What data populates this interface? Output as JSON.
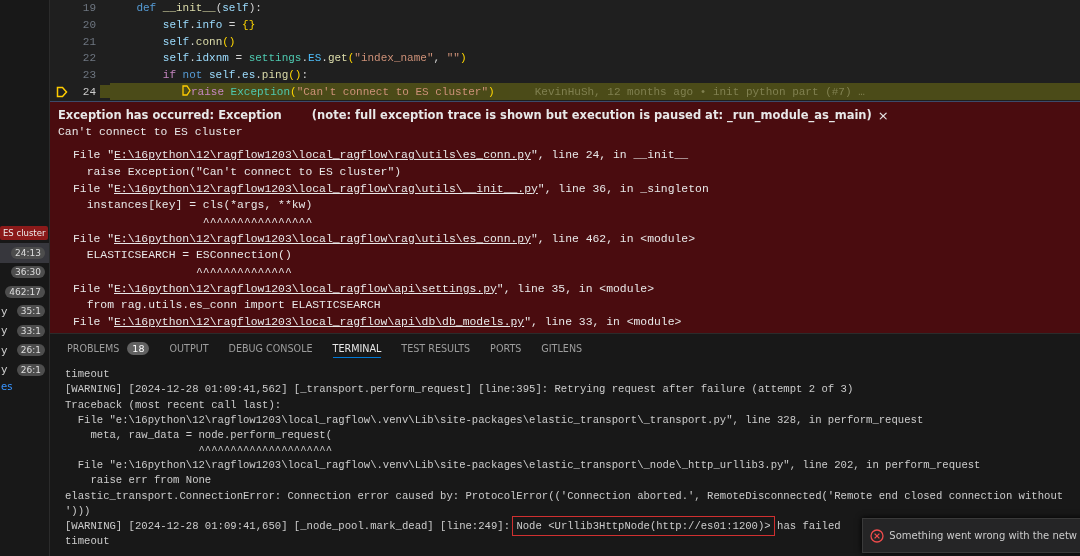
{
  "call_stack": {
    "exception_badge": "ES cluster",
    "frames": [
      {
        "position": "24:13",
        "selected": true
      },
      {
        "position": "36:30",
        "selected": false
      },
      {
        "position": "462:17",
        "selected": false
      },
      {
        "name": "y",
        "position": "35:1",
        "selected": false
      },
      {
        "name": "y",
        "position": "33:1",
        "selected": false
      },
      {
        "name": "y",
        "position": "26:1",
        "selected": false
      },
      {
        "name": "y",
        "position": "26:1",
        "selected": false
      }
    ],
    "more_link": "es"
  },
  "editor": {
    "lines": [
      {
        "number": "19",
        "current": false,
        "tokens": [
          {
            "kind": "keyword",
            "text": "    def"
          },
          {
            "kind": "function",
            "text": " __init__"
          },
          {
            "kind": "plain",
            "text": "("
          },
          {
            "kind": "variable",
            "text": "self"
          },
          {
            "kind": "plain",
            "text": "):"
          }
        ]
      },
      {
        "number": "20",
        "current": false,
        "tokens": [
          {
            "kind": "variable",
            "text": "        self"
          },
          {
            "kind": "plain",
            "text": "."
          },
          {
            "kind": "variable",
            "text": "info"
          },
          {
            "kind": "plain",
            "text": " = "
          },
          {
            "kind": "bracket",
            "text": "{}"
          }
        ]
      },
      {
        "number": "21",
        "current": false,
        "tokens": [
          {
            "kind": "variable",
            "text": "        self"
          },
          {
            "kind": "plain",
            "text": "."
          },
          {
            "kind": "function",
            "text": "conn"
          },
          {
            "kind": "bracket",
            "text": "()"
          }
        ]
      },
      {
        "number": "22",
        "current": false,
        "tokens": [
          {
            "kind": "variable",
            "text": "        self"
          },
          {
            "kind": "plain",
            "text": "."
          },
          {
            "kind": "variable",
            "text": "idxnm"
          },
          {
            "kind": "plain",
            "text": " = "
          },
          {
            "kind": "class",
            "text": "settings"
          },
          {
            "kind": "plain",
            "text": "."
          },
          {
            "kind": "constant",
            "text": "ES"
          },
          {
            "kind": "plain",
            "text": "."
          },
          {
            "kind": "function",
            "text": "get"
          },
          {
            "kind": "bracket",
            "text": "("
          },
          {
            "kind": "string",
            "text": "\"index_name\""
          },
          {
            "kind": "plain",
            "text": ", "
          },
          {
            "kind": "string",
            "text": "\"\""
          },
          {
            "kind": "bracket",
            "text": ")"
          }
        ]
      },
      {
        "number": "23",
        "current": false,
        "tokens": [
          {
            "kind": "control",
            "text": "        if"
          },
          {
            "kind": "keyword",
            "text": " not"
          },
          {
            "kind": "variable",
            "text": " self"
          },
          {
            "kind": "plain",
            "text": "."
          },
          {
            "kind": "variable",
            "text": "es"
          },
          {
            "kind": "plain",
            "text": "."
          },
          {
            "kind": "function",
            "text": "ping"
          },
          {
            "kind": "bracket",
            "text": "()"
          },
          {
            "kind": "plain",
            "text": ":"
          }
        ]
      },
      {
        "number": "24",
        "current": true,
        "blame": "KevinHuSh, 12 months ago • init python part (#7) …",
        "tokens": [
          {
            "kind": "control",
            "text": "raise"
          },
          {
            "kind": "class",
            "text": " Exception"
          },
          {
            "kind": "bracket",
            "text": "("
          },
          {
            "kind": "string",
            "text": "\"Can't connect to ES cluster\""
          },
          {
            "kind": "bracket",
            "text": ")"
          }
        ]
      }
    ]
  },
  "exception": {
    "title": "Exception has occurred: Exception",
    "note": "(note: full exception trace is shown but execution is paused at: _run_module_as_main)",
    "close": "×",
    "message": "Can't connect to ES cluster",
    "trace": [
      {
        "kind": "file",
        "prefix": "File \"",
        "path": "E:\\16python\\12\\ragflow1203\\local_ragflow\\rag\\utils\\es_conn.py",
        "suffix": "\", line 24, in __init__"
      },
      {
        "kind": "code",
        "text": "  raise Exception(\"Can't connect to ES cluster\")"
      },
      {
        "kind": "file",
        "prefix": "File \"",
        "path": "E:\\16python\\12\\ragflow1203\\local_ragflow\\rag\\utils\\__init__.py",
        "suffix": "\", line 36, in _singleton"
      },
      {
        "kind": "code",
        "text": "  instances[key] = cls(*args, **kw)"
      },
      {
        "kind": "code",
        "text": "                   ^^^^^^^^^^^^^^^^"
      },
      {
        "kind": "file",
        "prefix": "File \"",
        "path": "E:\\16python\\12\\ragflow1203\\local_ragflow\\rag\\utils\\es_conn.py",
        "suffix": "\", line 462, in <module>"
      },
      {
        "kind": "code",
        "text": "  ELASTICSEARCH = ESConnection()"
      },
      {
        "kind": "code",
        "text": "                  ^^^^^^^^^^^^^^"
      },
      {
        "kind": "file",
        "prefix": "File \"",
        "path": "E:\\16python\\12\\ragflow1203\\local_ragflow\\api\\settings.py",
        "suffix": "\", line 35, in <module>"
      },
      {
        "kind": "code",
        "text": "  from rag.utils.es_conn import ELASTICSEARCH"
      },
      {
        "kind": "file",
        "prefix": "File \"",
        "path": "E:\\16python\\12\\ragflow1203\\local_ragflow\\api\\db\\db_models.py",
        "suffix": "\", line 33, in <module>"
      }
    ]
  },
  "panel": {
    "tabs": [
      {
        "label": "PROBLEMS",
        "badge": "18",
        "selected": false
      },
      {
        "label": "OUTPUT",
        "selected": false
      },
      {
        "label": "DEBUG CONSOLE",
        "selected": false
      },
      {
        "label": "TERMINAL",
        "selected": true
      },
      {
        "label": "TEST RESULTS",
        "selected": false
      },
      {
        "label": "PORTS",
        "selected": false
      },
      {
        "label": "GITLENS",
        "selected": false
      }
    ],
    "terminal": [
      {
        "text": "timeout"
      },
      {
        "text": "[WARNING] [2024-12-28 01:09:41,562] [_transport.perform_request] [line:395]: Retrying request after failure (attempt 2 of 3)"
      },
      {
        "text": "Traceback (most recent call last):"
      },
      {
        "text": "  File \"e:\\16python\\12\\ragflow1203\\local_ragflow\\.venv\\Lib\\site-packages\\elastic_transport\\_transport.py\", line 328, in perform_request"
      },
      {
        "text": "    meta, raw_data = node.perform_request("
      },
      {
        "text": "                     ^^^^^^^^^^^^^^^^^^^^^"
      },
      {
        "text": "  File \"e:\\16python\\12\\ragflow1203\\local_ragflow\\.venv\\Lib\\site-packages\\elastic_transport\\_node\\_http_urllib3.py\", line 202, in perform_request"
      },
      {
        "text": "    raise err from None"
      },
      {
        "text": "elastic_transport.ConnectionError: Connection error caused by: ProtocolError(('Connection aborted.', RemoteDisconnected('Remote end closed connection without"
      },
      {
        "text": "')))"
      },
      {
        "text": "[WARNING] [2024-12-28 01:09:41,650] [_node_pool.mark_dead] [line:249]: ",
        "highlighted": "Node <Urllib3HttpNode(http://es01:1200)>",
        "after": " has failed"
      },
      {
        "text": "timeout"
      }
    ]
  },
  "toast": {
    "message": "Something went wrong with the netw"
  }
}
